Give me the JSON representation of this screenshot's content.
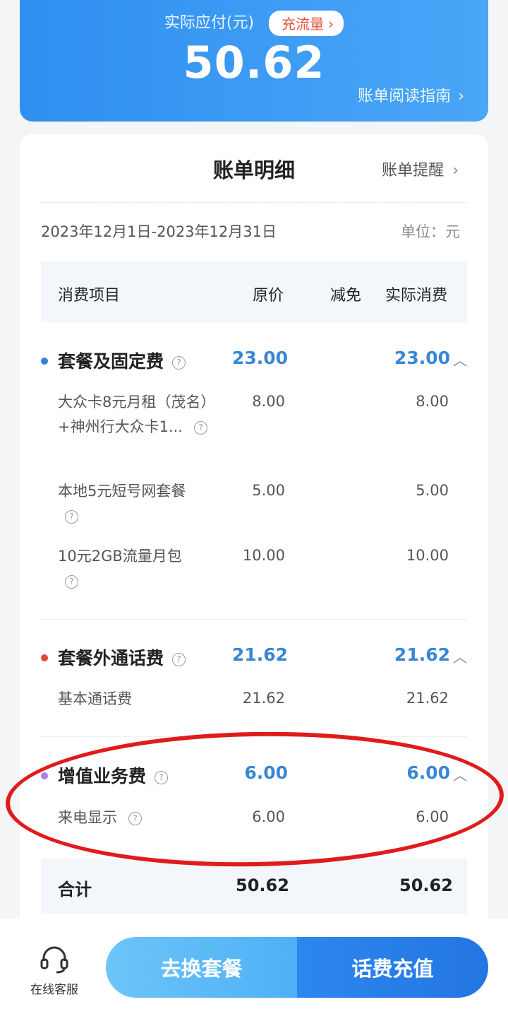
{
  "hero": {
    "label": "实际应付(元)",
    "chip": "充流量",
    "amount": "50.62",
    "guide": "账单阅读指南"
  },
  "card": {
    "title": "账单明细",
    "reminder": "账单提醒",
    "period": "2023年12月1日-2023年12月31日",
    "unit": "单位：元"
  },
  "table": {
    "headers": {
      "item": "消费项目",
      "original": "原价",
      "discount": "减免",
      "actual": "实际消费"
    },
    "groups": [
      {
        "name": "套餐及固定费",
        "original": "23.00",
        "actual": "23.00",
        "dot_color": "#2f86d8",
        "items": [
          {
            "name": "大众卡8元月租（茂名）+神州行大众卡1...",
            "original": "8.00",
            "actual": "8.00"
          },
          {
            "name": "本地5元短号网套餐",
            "original": "5.00",
            "actual": "5.00"
          },
          {
            "name": "10元2GB流量月包",
            "original": "10.00",
            "actual": "10.00"
          }
        ]
      },
      {
        "name": "套餐外通话费",
        "original": "21.62",
        "actual": "21.62",
        "dot_color": "#e5473d",
        "items": [
          {
            "name": "基本通话费",
            "original": "21.62",
            "actual": "21.62"
          }
        ]
      },
      {
        "name": "增值业务费",
        "original": "6.00",
        "actual": "6.00",
        "dot_color": "#b07de0",
        "items": [
          {
            "name": "来电显示",
            "original": "6.00",
            "actual": "6.00"
          }
        ]
      }
    ],
    "total": {
      "label": "合计",
      "original": "50.62",
      "actual": "50.62"
    }
  },
  "bottom": {
    "service_label": "在线客服",
    "change_plan": "去换套餐",
    "recharge": "话费充值"
  },
  "colors": {
    "accent_blue": "#3a86d6",
    "hero_blue": "#3a97f3",
    "annotation_red": "#e01b1b"
  }
}
